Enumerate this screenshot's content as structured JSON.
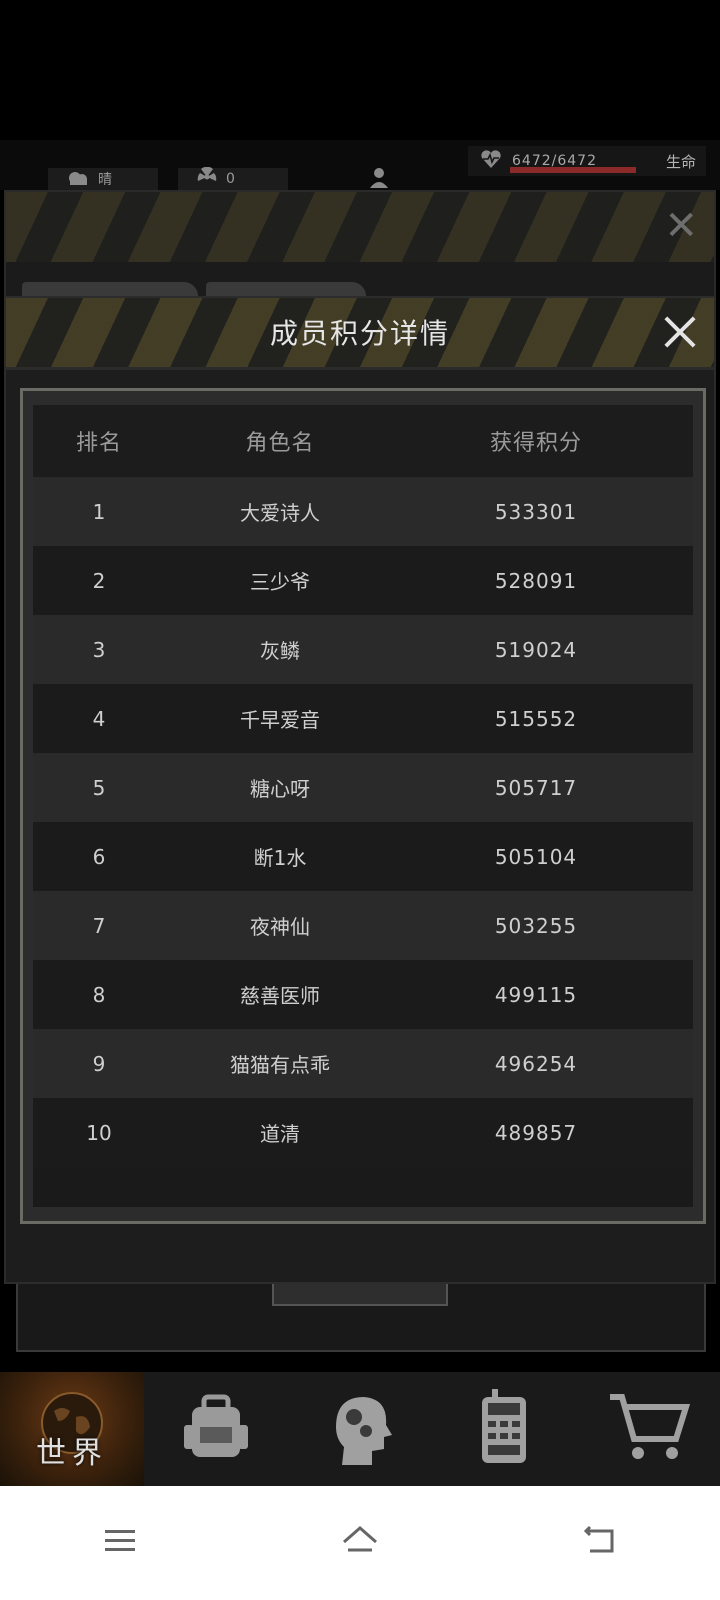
{
  "hud": {
    "weather_label": "晴",
    "radiation_value": "0",
    "health_value": "6472/6472",
    "health_fraction": 1.0,
    "health_label": "生命"
  },
  "modal": {
    "title": "成员积分详情",
    "columns": {
      "rank": "排名",
      "name": "角色名",
      "points": "获得积分"
    },
    "rows": [
      {
        "rank": "1",
        "name": "大爱诗人",
        "points": "533301"
      },
      {
        "rank": "2",
        "name": "三少爷",
        "points": "528091"
      },
      {
        "rank": "3",
        "name": "灰鳞",
        "points": "519024"
      },
      {
        "rank": "4",
        "name": "千早爱音",
        "points": "515552"
      },
      {
        "rank": "5",
        "name": "糖心呀",
        "points": "505717"
      },
      {
        "rank": "6",
        "name": "断1水",
        "points": "505104"
      },
      {
        "rank": "7",
        "name": "夜神仙",
        "points": "503255"
      },
      {
        "rank": "8",
        "name": "慈善医师",
        "points": "499115"
      },
      {
        "rank": "9",
        "name": "猫猫有点乖",
        "points": "496254"
      },
      {
        "rank": "10",
        "name": "道清",
        "points": "489857"
      }
    ]
  },
  "game_nav": {
    "world_label": "世界",
    "items": [
      "world-icon",
      "backpack-icon",
      "skills-icon",
      "radio-icon",
      "shop-cart-icon"
    ]
  },
  "colors": {
    "accent_stripe": "#4a4327",
    "health_bar": "#8c2a2a",
    "active_tab": "#6a3a16"
  }
}
